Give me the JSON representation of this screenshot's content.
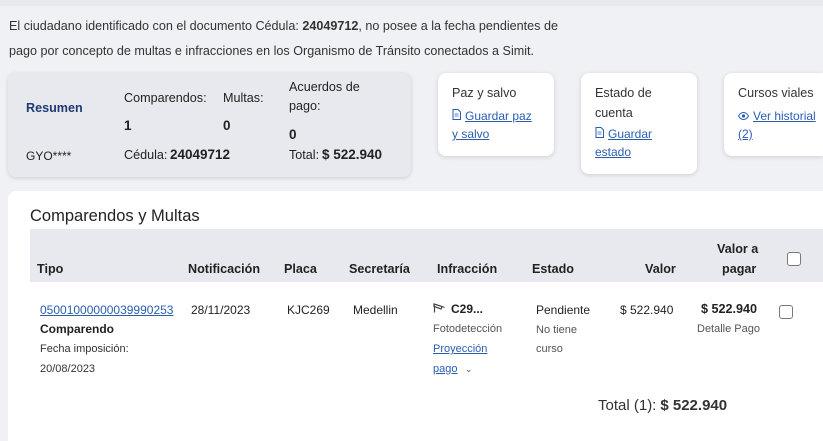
{
  "notice": {
    "line1_a": "El ciudadano identificado con el documento ",
    "line1_b": "Cédula: ",
    "line1_doc": "24049712",
    "line1_c": ", no posee a la fecha pendientes de",
    "line2": "pago por concepto de multas e infracciones en los Organismo de Tránsito conectados a Simit."
  },
  "summary": {
    "resumen_label": "Resumen",
    "user": "GYO****",
    "comparendos_label": "Comparendos:",
    "comparendos_value": "1",
    "multas_label": "Multas:",
    "multas_value": "0",
    "acuerdos_label_1": "Acuerdos de",
    "acuerdos_label_2": "pago:",
    "acuerdos_value": "0",
    "cedula_label": "Cédula:",
    "cedula_value": "24049712",
    "total_label": "Total:",
    "total_value": "$ 522.940"
  },
  "cards": {
    "paz": {
      "title": "Paz y salvo",
      "link1": "Guardar paz",
      "link2": "y salvo",
      "icon": "document-icon"
    },
    "estado": {
      "title1": "Estado de",
      "title2": "cuenta",
      "link1": "Guardar",
      "link2": "estado",
      "icon": "document-icon"
    },
    "cursos": {
      "title": "Cursos viales",
      "link1": "Ver historial",
      "link2": "(2)",
      "icon": "eye-icon"
    }
  },
  "table": {
    "heading": "Comparendos y Multas",
    "columns": {
      "tipo": "Tipo",
      "notificacion": "Notificación",
      "placa": "Placa",
      "secretaria": "Secretaría",
      "infraccion": "Infracción",
      "estado": "Estado",
      "valor": "Valor",
      "valor_pagar_1": "Valor a",
      "valor_pagar_2": "pagar"
    },
    "row": {
      "numero": "05001000000039990253",
      "tipo": "Comparendo",
      "fecha_label": "Fecha imposición:",
      "fecha": "20/08/2023",
      "notificacion": "28/11/2023",
      "placa": "KJC269",
      "secretaria": "Medellin",
      "infraccion_code": "C29...",
      "infraccion_sub": "Fotodetección",
      "proyeccion_1": "Proyección",
      "proyeccion_2": "pago",
      "estado": "Pendiente",
      "estado_sub_1": "No tiene",
      "estado_sub_2": "curso",
      "valor": "$ 522.940",
      "valor_pagar": "$ 522.940",
      "detalle": "Detalle Pago"
    },
    "total_label": "Total (1):",
    "total_value": "$ 522.940"
  }
}
